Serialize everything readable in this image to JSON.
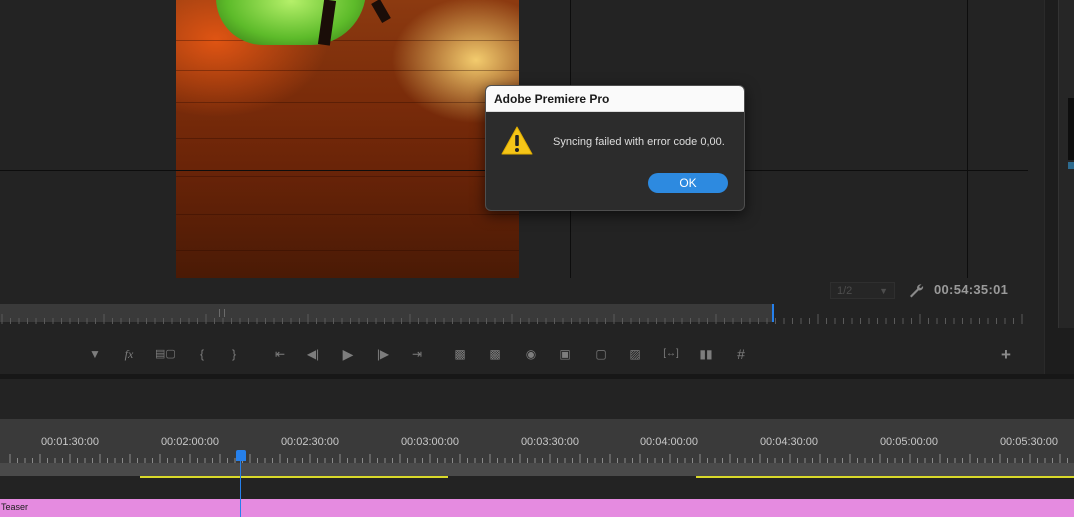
{
  "monitor": {
    "zoom_select": "1/2",
    "timecode": "00:54:35:01"
  },
  "transport": {
    "icons": [
      "marker-icon",
      "fx-icon",
      "insert-edit-icon",
      "mark-in-icon",
      "mark-out-icon",
      "go-to-in-icon",
      "step-back-icon",
      "play-icon",
      "step-forward-icon",
      "go-to-out-icon",
      "lift-icon",
      "extract-icon",
      "export-frame-icon",
      "comparison-view-icon",
      "safe-margins-icon",
      "multicam-icon",
      "vr-icon",
      "settings-icon",
      "grid-icon"
    ],
    "add": "+"
  },
  "timeline": {
    "ruler_labels": [
      "00:01:30:00",
      "00:02:00:00",
      "00:02:30:00",
      "00:03:00:00",
      "00:03:30:00",
      "00:04:00:00",
      "00:04:30:00",
      "00:05:00:00",
      "00:05:30:00"
    ],
    "clip_name": "Teaser",
    "clip_color": "#e58be0",
    "playhead_color": "#2680eb"
  },
  "dialog": {
    "title": "Adobe Premiere Pro",
    "message": "Syncing failed with error code 0,00.",
    "ok_label": "OK",
    "icon": "warning-icon"
  }
}
